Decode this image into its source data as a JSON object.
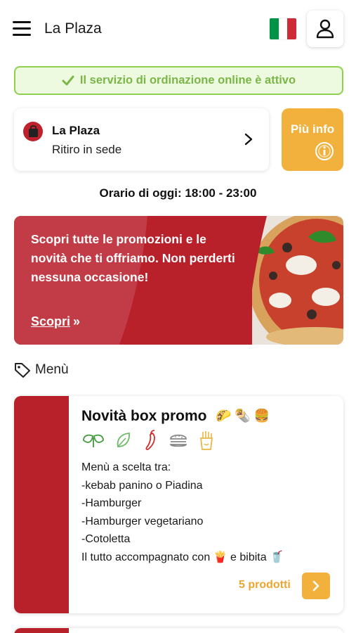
{
  "header": {
    "title": "La Plaza",
    "language_flag": "italian-flag",
    "flag_colors": [
      "#009246",
      "#ffffff",
      "#ce2b37"
    ]
  },
  "status_banner": {
    "text": "Il servizio di ordinazione online è attivo",
    "icon": "check-icon",
    "color": "#7ab648"
  },
  "store": {
    "name": "La Plaza",
    "mode": "Ritiro in sede",
    "icon": "shopping-bag-icon"
  },
  "info_button": {
    "label": "Più info",
    "icon": "info-icon"
  },
  "hours": {
    "text": "Orario di oggi: 18:00 - 23:00"
  },
  "promo": {
    "text": "Scopri tutte le promozioni e le novità che ti offriamo. Non perderti nessuna occasione!",
    "link_label": "Scopri",
    "link_arrow": "»"
  },
  "menu_section": {
    "label": "Menù",
    "icon": "tag-icon"
  },
  "product": {
    "title": "Novità box promo",
    "title_emojis": "🌮 🌯 🍔",
    "attribute_icons": [
      "vegan-icon",
      "vegetarian-icon",
      "spicy-icon",
      "burger-icon",
      "fries-icon"
    ],
    "description_lines": [
      "Menù a scelta tra:",
      "-kebab panino o Piadina",
      "-Hamburger",
      "-Hamburger vegetariano",
      "-Cotoletta",
      "Il tutto accompagnato con 🍟 e bibita 🥤"
    ],
    "count_label": "5 prodotti"
  },
  "colors": {
    "brand_red": "#b8202a",
    "accent_orange": "#f2b13c",
    "success_green": "#8fd14f"
  }
}
